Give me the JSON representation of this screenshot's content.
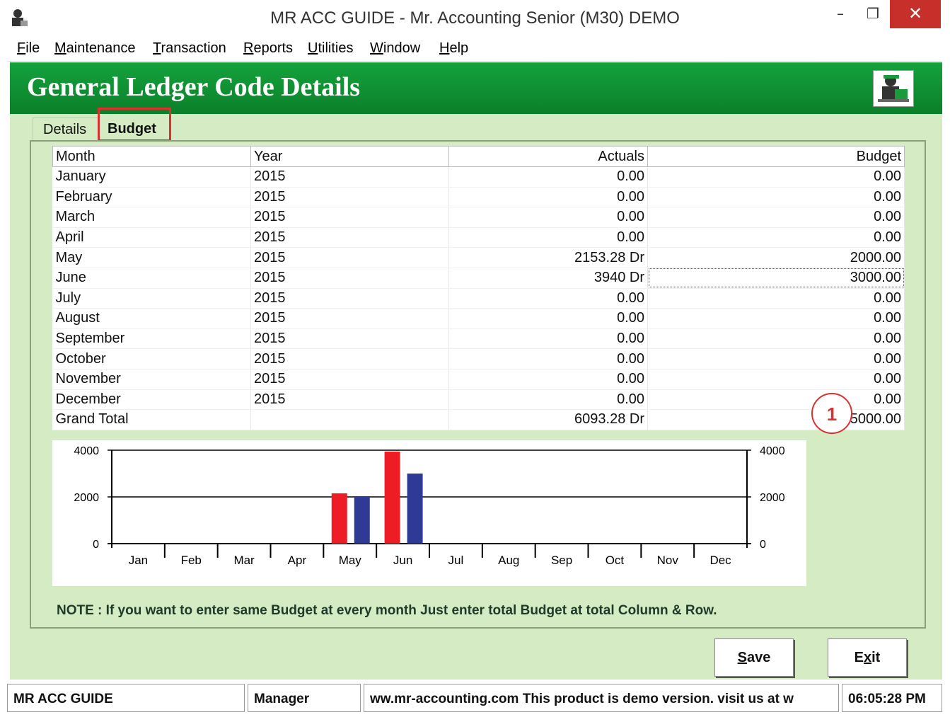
{
  "window": {
    "title": "MR ACC GUIDE - Mr. Accounting Senior (M30) DEMO",
    "minimize": "–",
    "maximize": "❐",
    "close": "✕"
  },
  "menu": [
    {
      "key": "F",
      "rest": "ile"
    },
    {
      "key": "M",
      "rest": "aintenance"
    },
    {
      "key": "T",
      "rest": "ransaction"
    },
    {
      "key": "R",
      "rest": "eports"
    },
    {
      "key": "U",
      "rest": "tilities"
    },
    {
      "key": "W",
      "rest": "indow"
    },
    {
      "key": "H",
      "rest": "elp"
    }
  ],
  "banner": {
    "title": "General Ledger Code Details"
  },
  "tabs": {
    "details": "Details",
    "budget": "Budget"
  },
  "callout": "1",
  "grid": {
    "headers": [
      "Month",
      "Year",
      "Actuals",
      "Budget"
    ],
    "rows": [
      {
        "month": "January",
        "year": "2015",
        "actual": "0.00",
        "budget": "0.00"
      },
      {
        "month": "February",
        "year": "2015",
        "actual": "0.00",
        "budget": "0.00"
      },
      {
        "month": "March",
        "year": "2015",
        "actual": "0.00",
        "budget": "0.00"
      },
      {
        "month": "April",
        "year": "2015",
        "actual": "0.00",
        "budget": "0.00"
      },
      {
        "month": "May",
        "year": "2015",
        "actual": "2153.28  Dr",
        "budget": "2000.00"
      },
      {
        "month": "June",
        "year": "2015",
        "actual": "3940  Dr",
        "budget": "3000.00"
      },
      {
        "month": "July",
        "year": "2015",
        "actual": "0.00",
        "budget": "0.00"
      },
      {
        "month": "August",
        "year": "2015",
        "actual": "0.00",
        "budget": "0.00"
      },
      {
        "month": "September",
        "year": "2015",
        "actual": "0.00",
        "budget": "0.00"
      },
      {
        "month": "October",
        "year": "2015",
        "actual": "0.00",
        "budget": "0.00"
      },
      {
        "month": "November",
        "year": "2015",
        "actual": "0.00",
        "budget": "0.00"
      },
      {
        "month": "December",
        "year": "2015",
        "actual": "0.00",
        "budget": "0.00"
      },
      {
        "month": "Grand Total",
        "year": "",
        "actual": "6093.28 Dr",
        "budget": "5000.00"
      }
    ]
  },
  "chart_data": {
    "type": "bar",
    "categories": [
      "Jan",
      "Feb",
      "Mar",
      "Apr",
      "May",
      "Jun",
      "Jul",
      "Aug",
      "Sep",
      "Oct",
      "Nov",
      "Dec"
    ],
    "series": [
      {
        "name": "Actuals",
        "color": "#ee1c25",
        "values": [
          0,
          0,
          0,
          0,
          2153.28,
          3940,
          0,
          0,
          0,
          0,
          0,
          0
        ]
      },
      {
        "name": "Budget",
        "color": "#2e3a96",
        "values": [
          0,
          0,
          0,
          0,
          2000,
          3000,
          0,
          0,
          0,
          0,
          0,
          0
        ]
      }
    ],
    "ylim": [
      0,
      4000
    ],
    "yticks": [
      0,
      2000,
      4000
    ],
    "grid": "horizontal",
    "legend_position": "right"
  },
  "note": "NOTE : If you want to enter same Budget at every month Just enter total Budget at total Column & Row.",
  "buttons": {
    "save": {
      "key": "S",
      "rest": "ave"
    },
    "exit": {
      "pre": "E",
      "key": "x",
      "rest": "it"
    }
  },
  "status": {
    "app": "MR ACC GUIDE",
    "user": "Manager",
    "message": "ww.mr-accounting.com This product is demo version.  visit us at w",
    "time": "06:05:28 PM"
  }
}
